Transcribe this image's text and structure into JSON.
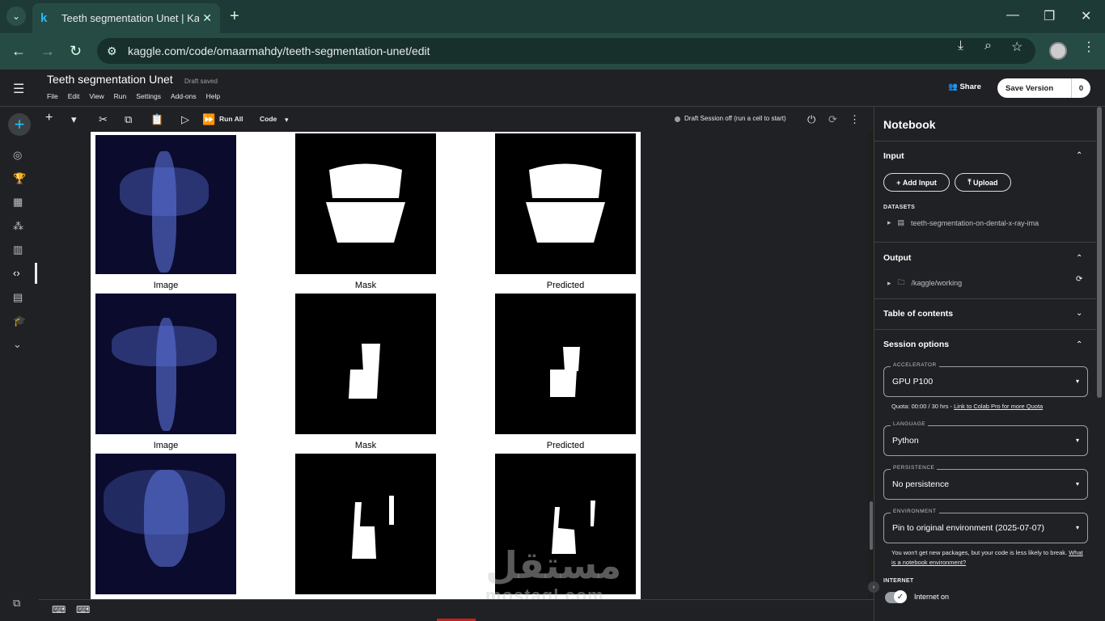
{
  "browser": {
    "tab_title": "Teeth segmentation Unet | Kaggle",
    "tab_favicon": "k",
    "url": "kaggle.com/code/omaarmahdy/teeth-segmentation-unet/edit"
  },
  "header": {
    "title": "Teeth segmentation Unet",
    "status": "Draft saved",
    "menu": [
      "File",
      "Edit",
      "View",
      "Run",
      "Settings",
      "Add-ons",
      "Help"
    ],
    "share_label": "Share",
    "save_version_label": "Save Version",
    "save_version_count": "0"
  },
  "toolbar": {
    "run_all_label": "Run All",
    "cell_type_label": "Code",
    "session_status": "Draft Session off (run a cell to start)"
  },
  "output": {
    "captions": [
      "Image",
      "Mask",
      "Predicted"
    ]
  },
  "panel": {
    "title": "Notebook",
    "input": {
      "heading": "Input",
      "add_input_label": "Add Input",
      "upload_label": "Upload",
      "datasets_label": "DATASETS",
      "dataset_name": "teeth-segmentation-on-dental-x-ray-ima"
    },
    "output": {
      "heading": "Output",
      "path": "/kaggle/working"
    },
    "toc_heading": "Table of contents",
    "session_options": {
      "heading": "Session options",
      "accelerator_label": "ACCELERATOR",
      "accelerator_value": "GPU P100",
      "quota_text": "Quota: 00:00 / 30 hrs - ",
      "quota_link": "Link to Colab Pro for more Quota",
      "language_label": "LANGUAGE",
      "language_value": "Python",
      "persistence_label": "PERSISTENCE",
      "persistence_value": "No persistence",
      "environment_label": "ENVIRONMENT",
      "environment_value": "Pin to original environment (2025-07-07)",
      "environment_note": "You won't get new packages, but your code is less likely to break. ",
      "environment_link": "What is a notebook environment?",
      "internet_label": "INTERNET",
      "internet_value": "Internet on",
      "internet_enabled": true
    }
  },
  "watermark": {
    "arabic": "مستقل",
    "latin": "mostaql.com"
  }
}
